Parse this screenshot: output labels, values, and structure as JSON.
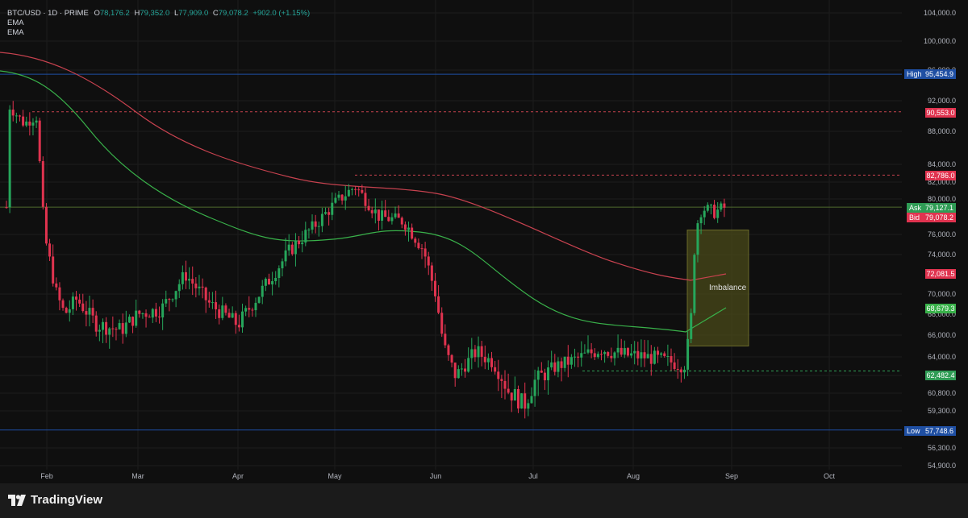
{
  "legend": {
    "symbol": "BTC/USD · 1D · PRIME",
    "open_label": "O",
    "open": "78,176.2",
    "high_label": "H",
    "high": "79,352.0",
    "low_label": "L",
    "low": "77,909.0",
    "close_label": "C",
    "close": "79,078.2",
    "change": "+902.0 (+1.15%)",
    "indicator1": "EMA",
    "indicator2": "EMA"
  },
  "branding": {
    "name": "TradingView",
    "logo_icon": "tradingview-logo-icon"
  },
  "colors": {
    "background": "#0f0f0f",
    "grid": "#1c1c1c",
    "up": "#26a65b",
    "down": "#e0334f",
    "ema_fast": "#39b14a",
    "ema_slow": "#c7424f",
    "imbalance": "#4a4a1a",
    "high_tag": "#1f4fa3",
    "resistance": "#c7424f",
    "support": "#2f9c55"
  },
  "price_tags": {
    "high_label": "High",
    "high_value": "95,454.9",
    "ask_label": "Ask",
    "ask_value": "79,127.1",
    "bid_label": "Bid",
    "bid_value": "79,078.2",
    "low_label": "Low",
    "low_value": "57,748.6",
    "level_90553": "90,553.0",
    "level_82786": "82,786.0",
    "ema_slow_value": "72,081.5",
    "ema_fast_value": "68,679.3",
    "level_62482": "62,482.4"
  },
  "annotation": {
    "imbalance_label": "Imbalance"
  },
  "chart_data": {
    "type": "candlestick",
    "y_axis_ticks": [
      "104,000.0",
      "100,000.0",
      "96,000.0",
      "92,000.0",
      "88,000.0",
      "84,000.0",
      "82,000.0",
      "80,000.0",
      "76,000.0",
      "74,000.0",
      "70,000.0",
      "68,000.0",
      "66,000.0",
      "64,000.0",
      "62,000.0",
      "60,800.0",
      "59,300.0",
      "56,300.0",
      "54,900.0"
    ],
    "x_axis_ticks": [
      "Feb",
      "Mar",
      "Apr",
      "May",
      "Jun",
      "Jul",
      "Aug",
      "Sep",
      "Oct"
    ],
    "levels": {
      "high": 95454.9,
      "resistance_1": 90553.0,
      "resistance_2": 82786.0,
      "support": 62482.4,
      "low": 57748.6,
      "last": 79078.2
    },
    "ema_fast_last": 68679.3,
    "ema_slow_last": 72081.5,
    "imbalance_zone": {
      "from": 65000,
      "to": 76500
    }
  }
}
